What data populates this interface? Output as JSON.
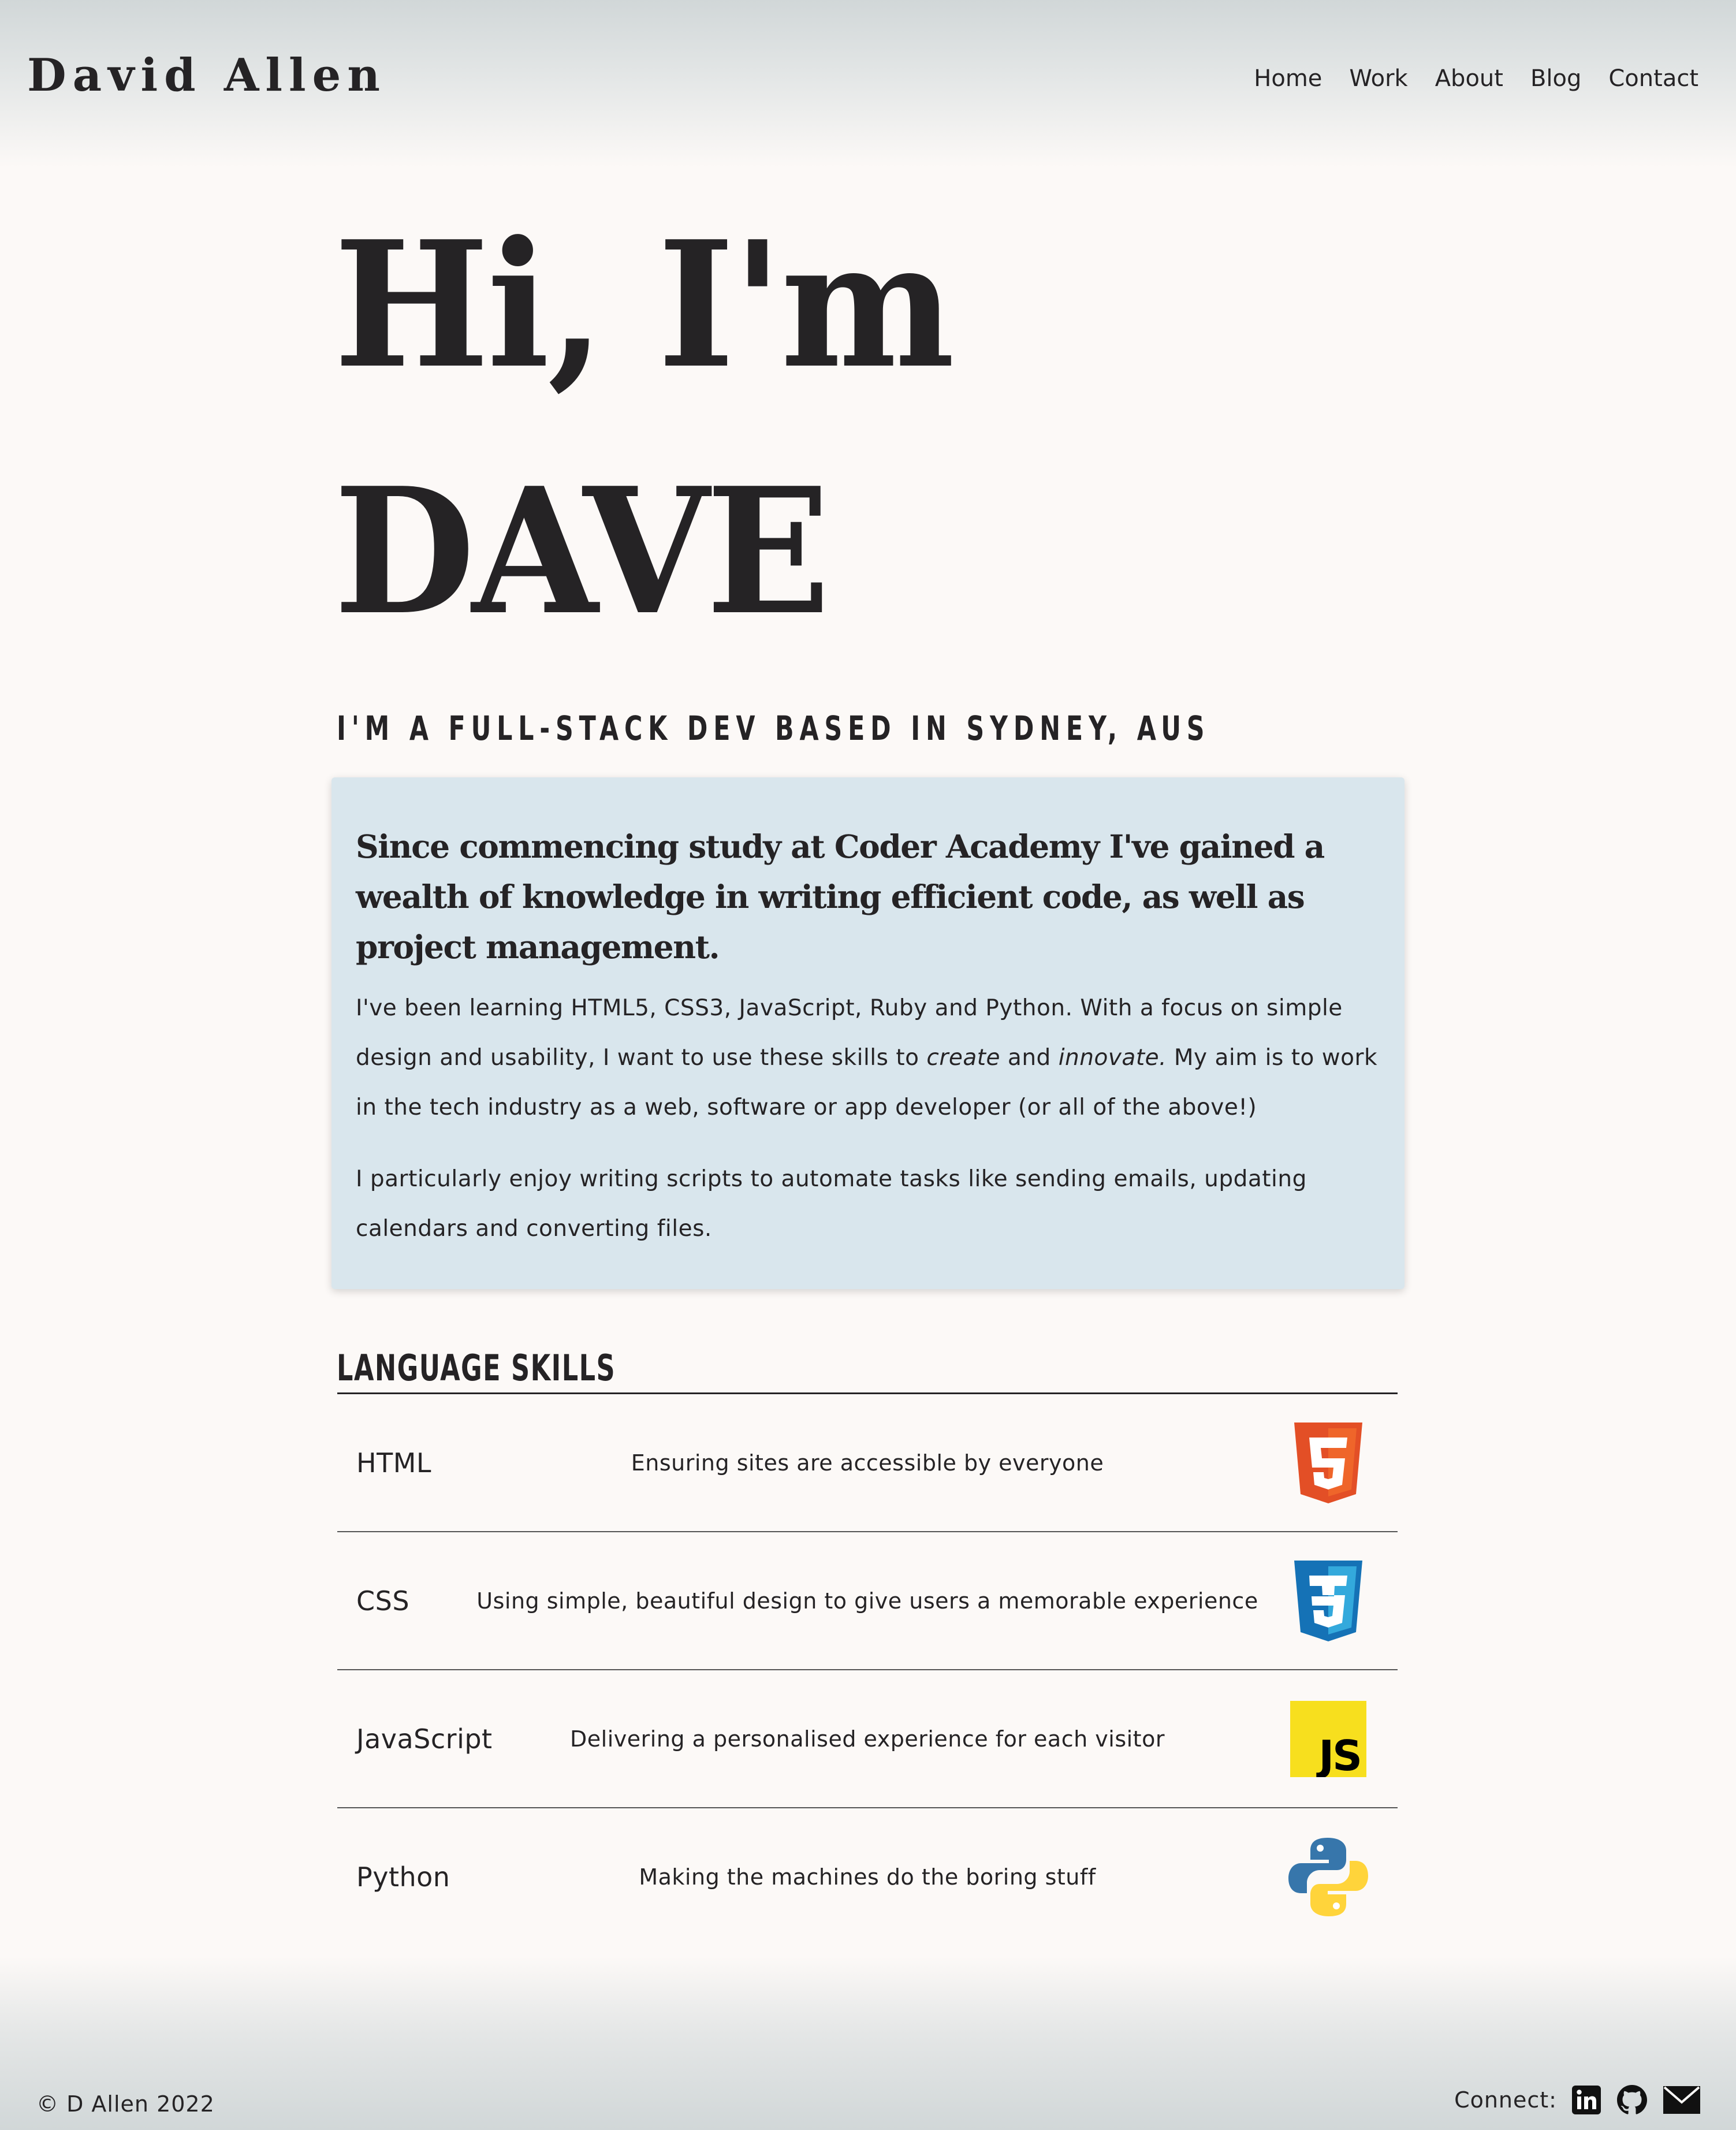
{
  "header": {
    "brand": "David Allen",
    "nav": [
      "Home",
      "Work",
      "About",
      "Blog",
      "Contact"
    ]
  },
  "hero": {
    "line1": "Hi, I'm",
    "line2": "DAVE",
    "tagline": "I'M A FULL-STACK DEV BASED IN SYDNEY, AUS"
  },
  "intro": {
    "lead": "Since commencing study at Coder Academy I've gained a wealth of knowledge in writing efficient code, as well as project management.",
    "p1_a": "I've been learning HTML5, CSS3, JavaScript, Ruby and Python. With a focus on simple design and usability, I want to use these skills to ",
    "p1_em1": "create",
    "p1_b": " and ",
    "p1_em2": "innovate.",
    "p1_c": " My aim is to work in the tech industry as a web, software or app developer (or all of the above!)",
    "p2": "I particularly enjoy writing scripts to automate tasks like sending emails, updating calendars and converting files."
  },
  "skills": {
    "title": "LANGUAGE SKILLS",
    "items": [
      {
        "name": "HTML",
        "desc": "Ensuring sites are accessible by everyone",
        "icon": "html5-icon"
      },
      {
        "name": "CSS",
        "desc": "Using simple, beautiful design to give users a memorable experience",
        "icon": "css3-icon"
      },
      {
        "name": "JavaScript",
        "desc": "Delivering a personalised experience for each visitor",
        "icon": "javascript-icon"
      },
      {
        "name": "Python",
        "desc": "Making the machines do the boring stuff",
        "icon": "python-icon"
      }
    ]
  },
  "footer": {
    "copyright": "© D Allen 2022",
    "connect_label": "Connect:",
    "icons": [
      "linkedin-icon",
      "github-icon",
      "mail-icon"
    ]
  },
  "colors": {
    "background": "#fcf9f7",
    "text": "#252325",
    "card": "#d9e6ed",
    "html5": "#e34f26",
    "css3": "#1572b6",
    "js": "#f7df1e",
    "python_blue": "#3776ab",
    "python_yellow": "#ffd43b"
  }
}
